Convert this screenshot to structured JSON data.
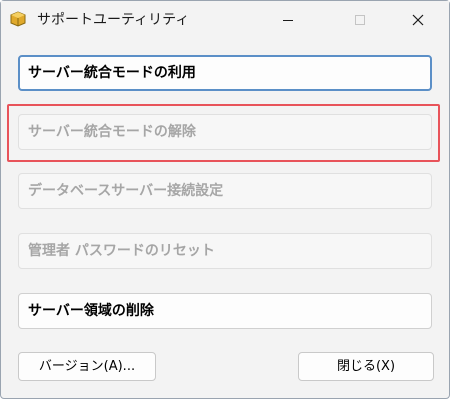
{
  "window": {
    "title": "サポートユーティリティ"
  },
  "titlebar": {
    "icons": [
      "app-icon",
      "minimize-icon",
      "maximize-icon",
      "close-icon"
    ]
  },
  "buttons": {
    "server_integration_use": "サーバー統合モードの利用",
    "server_integration_cancel": "サーバー統合モードの解除",
    "db_server_connection_settings": "データベースサーバー接続設定",
    "admin_password_reset": "管理者 パスワードのリセット",
    "server_area_delete": "サーバー領域の削除",
    "version": "バージョン(A)...",
    "close": "閉じる(X)"
  },
  "colors": {
    "default_button_border": "#5b8fc7",
    "highlight_border": "#e8535a",
    "disabled_text": "#a6a6a6"
  }
}
